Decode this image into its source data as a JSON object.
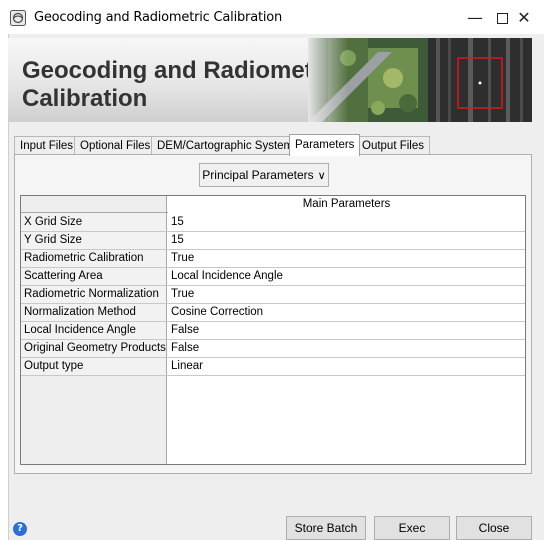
{
  "window": {
    "title": "Geocoding and Radiometric Calibration",
    "minimize_glyph": "—",
    "close_glyph": "✕"
  },
  "banner": {
    "title_line1": "Geocoding and Radiometric",
    "title_line2": "Calibration"
  },
  "tabs": [
    {
      "label": "Input Files",
      "active": false
    },
    {
      "label": "Optional Files",
      "active": false
    },
    {
      "label": "DEM/Cartographic System",
      "active": false
    },
    {
      "label": "Parameters",
      "active": true
    },
    {
      "label": "Output Files",
      "active": false
    }
  ],
  "parameters": {
    "dropdown_value": "Principal Parameters",
    "column_header": "Main Parameters",
    "rows": [
      {
        "key": "X Grid Size",
        "value": "15"
      },
      {
        "key": "Y Grid Size",
        "value": "15"
      },
      {
        "key": "Radiometric Calibration",
        "value": "True"
      },
      {
        "key": "Scattering Area",
        "value": "Local Incidence Angle"
      },
      {
        "key": "Radiometric Normalization",
        "value": "True"
      },
      {
        "key": "Normalization Method",
        "value": "Cosine Correction"
      },
      {
        "key": "Local Incidence Angle",
        "value": "False"
      },
      {
        "key": "Original Geometry Products",
        "value": "False"
      },
      {
        "key": "Output type",
        "value": "Linear"
      }
    ]
  },
  "footer": {
    "help_glyph": "?",
    "store_batch_label": "Store Batch",
    "exec_label": "Exec",
    "close_label": "Close"
  },
  "colors": {
    "help_icon": "#2e6fd1",
    "banner_text": "#333333"
  }
}
